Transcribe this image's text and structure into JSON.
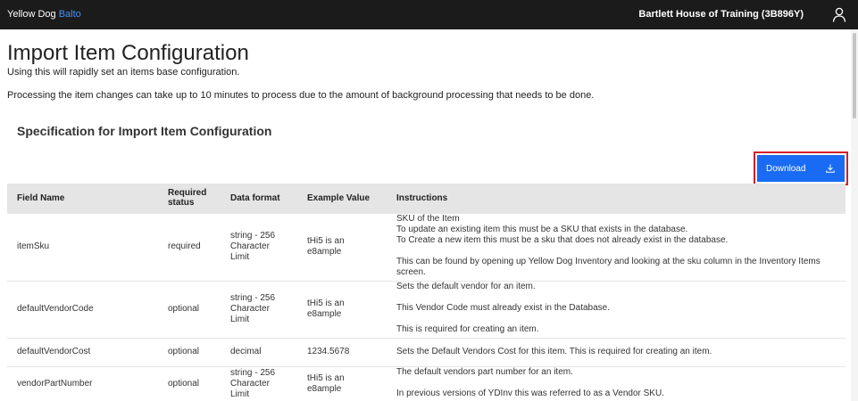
{
  "topbar": {
    "brand_main": "Yellow Dog",
    "brand_accent": "Balto",
    "organization": "Bartlett House of Training (3B896Y)",
    "user_icon": "user-icon"
  },
  "page": {
    "title": "Import Item Configuration",
    "subtitle": "Using this will rapidly set an items base configuration.",
    "note": "Processing the item changes can take up to 10 minutes to process due to the amount of background processing that needs to be done.",
    "section_title": "Specification for Import Item Configuration"
  },
  "download": {
    "label": "Download",
    "icon": "download-icon",
    "highlight_color": "#d0202a",
    "button_color": "#1a6bf3"
  },
  "table": {
    "headers": {
      "field_name": "Field Name",
      "required_line1": "Required",
      "required_line2": "status",
      "data_format": "Data format",
      "example_value": "Example Value",
      "instructions": "Instructions"
    },
    "rows": [
      {
        "field_name": "itemSku",
        "required": "required",
        "format": [
          "string - 256",
          "Character",
          "Limit"
        ],
        "example": [
          "tHi5 is an",
          "e8ample"
        ],
        "instructions": [
          "SKU of the Item",
          "To update an existing item this must be a SKU that exists in the database.",
          "To Create a new item this must be a sku that does not already exist in the database.",
          "",
          "This can be found by opening up Yellow Dog Inventory and looking at the sku column in the Inventory Items",
          "screen."
        ]
      },
      {
        "field_name": "defaultVendorCode",
        "required": "optional",
        "format": [
          "string - 256",
          "Character",
          "Limit"
        ],
        "example": [
          "tHi5 is an",
          "e8ample"
        ],
        "instructions": [
          "Sets the default vendor for an item.",
          "",
          "This Vendor Code must already exist in the Database.",
          "",
          "This is required for creating an item."
        ]
      },
      {
        "field_name": "defaultVendorCost",
        "required": "optional",
        "format": [
          "decimal"
        ],
        "example": [
          "1234.5678"
        ],
        "instructions": [
          "Sets the Default Vendors Cost for this item. This is required for creating an item."
        ]
      },
      {
        "field_name": "vendorPartNumber",
        "required": "optional",
        "format": [
          "string - 256",
          "Character",
          "Limit"
        ],
        "example": [
          "tHi5 is an",
          "e8ample"
        ],
        "instructions": [
          "The default vendors part number for an item.",
          "",
          "In previous versions of YDInv this was referred to as a Vendor SKU."
        ]
      }
    ]
  }
}
